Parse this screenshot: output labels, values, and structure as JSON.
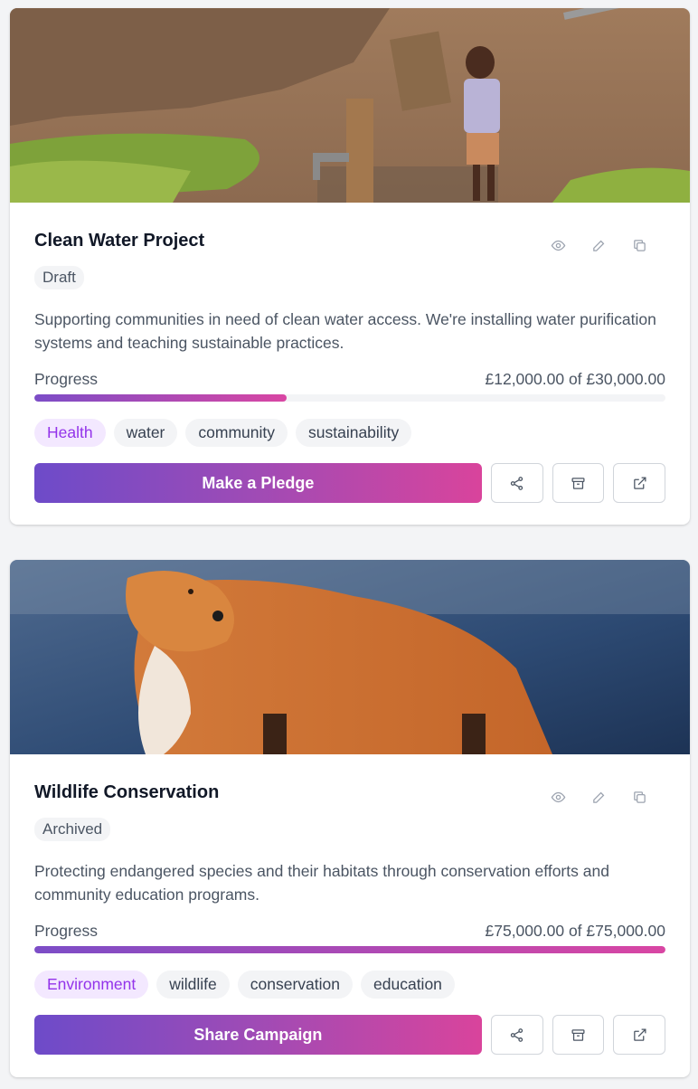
{
  "campaigns": [
    {
      "title": "Clean Water Project",
      "status": "Draft",
      "description": "Supporting communities in need of clean water access. We're installing water purification systems and teaching sustainable practices.",
      "progress_label": "Progress",
      "progress_amount": "£12,000.00 of £30,000.00",
      "progress_fraction": 0.4,
      "tags": [
        "Health",
        "water",
        "community",
        "sustainability"
      ],
      "action_label": "Make a Pledge",
      "icons": [
        "eye-icon",
        "pencil-icon",
        "copy-icon",
        "share-icon",
        "archive-icon",
        "external-link-icon"
      ]
    },
    {
      "title": "Wildlife Conservation",
      "status": "Archived",
      "description": "Protecting endangered species and their habitats through conservation efforts and community education programs.",
      "progress_label": "Progress",
      "progress_amount": "£75,000.00 of £75,000.00",
      "progress_fraction": 1.0,
      "tags": [
        "Environment",
        "wildlife",
        "conservation",
        "education"
      ],
      "action_label": "Share Campaign",
      "icons": [
        "eye-icon",
        "pencil-icon",
        "copy-icon",
        "share-icon",
        "archive-icon",
        "external-link-icon"
      ]
    }
  ],
  "colors": {
    "gradient_start": "#6d4bc9",
    "gradient_end": "#d9449c",
    "primary_tag_bg": "#f3e8ff",
    "primary_tag_text": "#9333ea"
  }
}
